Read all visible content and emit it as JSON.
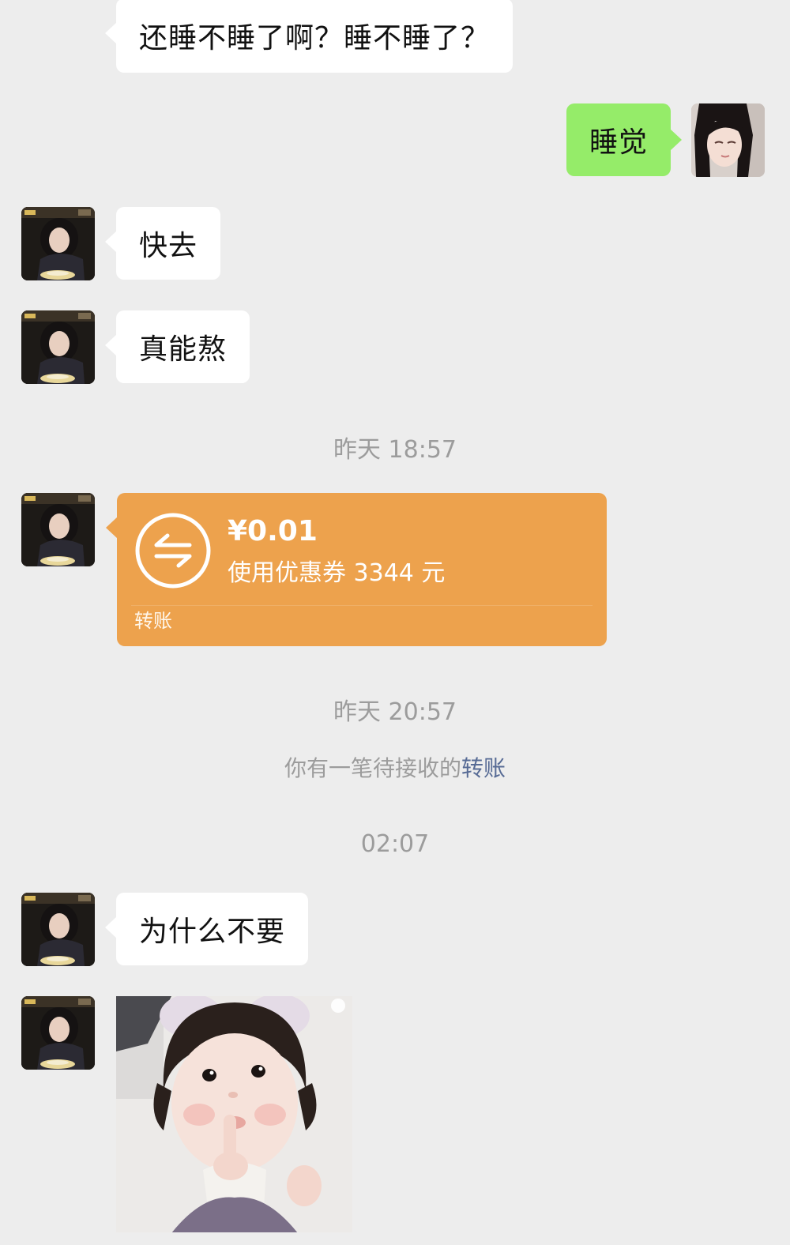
{
  "messages": [
    {
      "id": "m1",
      "side": "in",
      "text": "还睡不睡了啊？睡不睡了？"
    },
    {
      "id": "m2",
      "side": "out",
      "text": "睡觉"
    },
    {
      "id": "m3",
      "side": "in",
      "text": "快去"
    },
    {
      "id": "m4",
      "side": "in",
      "text": "真能熬"
    },
    {
      "id": "m5",
      "side": "in",
      "text": "为什么不要"
    }
  ],
  "timestamps": {
    "t1": "昨天 18:57",
    "t2": "昨天 20:57",
    "t3": "02:07"
  },
  "transfer": {
    "amount": "¥0.01",
    "note": "使用优惠券 3344 元",
    "kind_label": "转账",
    "icon": "transfer-arrows-icon"
  },
  "system_notice": {
    "text": "你有一笔待接收的",
    "link": "转账"
  },
  "colors": {
    "background": "#ededed",
    "incoming_bubble": "#ffffff",
    "outgoing_bubble": "#95ec69",
    "transfer_card": "#eda24d",
    "link": "#576b95",
    "timestamp": "#9c9c9c"
  }
}
